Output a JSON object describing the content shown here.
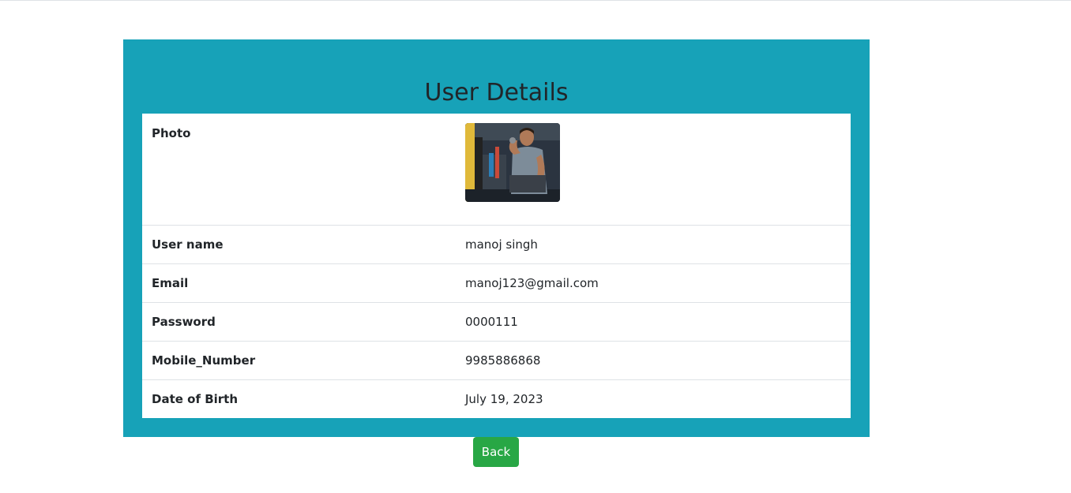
{
  "page": {
    "title": "User Details"
  },
  "details": {
    "photo_label": "Photo",
    "rows": [
      {
        "label": "User name",
        "value": "manoj singh"
      },
      {
        "label": "Email",
        "value": "manoj123@gmail.com"
      },
      {
        "label": "Password",
        "value": "0000111"
      },
      {
        "label": "Mobile_Number",
        "value": "9985886868"
      },
      {
        "label": "Date of Birth",
        "value": "July 19, 2023"
      }
    ]
  },
  "actions": {
    "back_label": "Back"
  },
  "colors": {
    "card_background": "#17a2b8",
    "back_button": "#28a745"
  }
}
